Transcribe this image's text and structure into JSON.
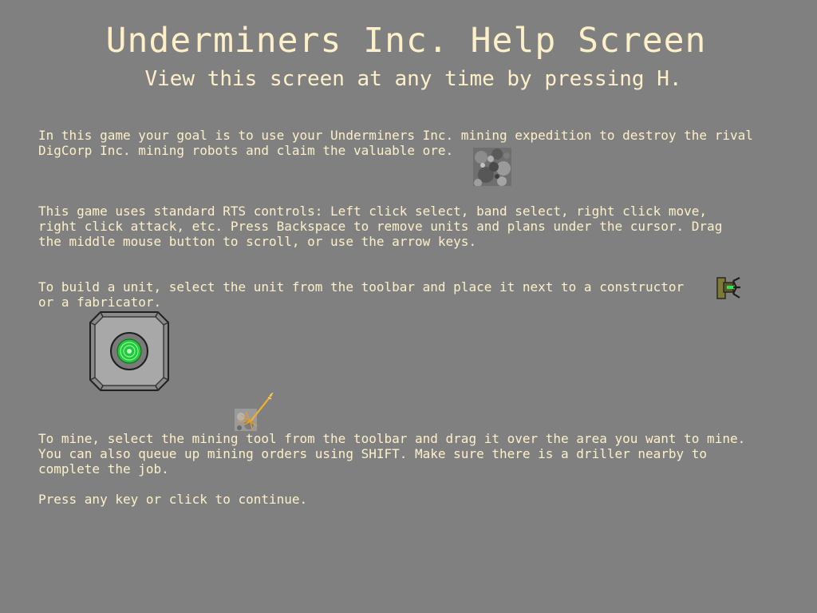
{
  "title": "Underminers Inc. Help Screen",
  "subtitle": "View this screen at any time by pressing H.",
  "paragraphs": {
    "goal": [
      "In this game your goal is to use your Underminers Inc. mining expedition to destroy the rival",
      "DigCorp Inc. mining robots and claim the valuable ore."
    ],
    "controls": [
      "This game uses standard RTS controls: Left click select, band select, right click move,",
      "right click attack, etc. Press Backspace to remove units and plans under the cursor. Drag",
      "the middle mouse button to scroll, or use the arrow keys."
    ],
    "build": [
      "To build a unit, select the unit from the toolbar and place it next to a constructor",
      "or a fabricator."
    ],
    "mine": [
      "To mine, select the mining tool from the toolbar and drag it over the area you want to mine.",
      "You can also queue up mining orders using SHIFT. Make sure there is a driller nearby to",
      "complete the job."
    ],
    "continue": "Press any key or click to continue."
  },
  "icons": {
    "ore": "ore-icon",
    "constructor": "constructor-icon",
    "fabricator": "fabricator-icon",
    "mining_tool": "mining-tool-icon"
  },
  "colors": {
    "background": "#808080",
    "text": "#fdf0c8",
    "fabricator_core": "#22c83a"
  }
}
